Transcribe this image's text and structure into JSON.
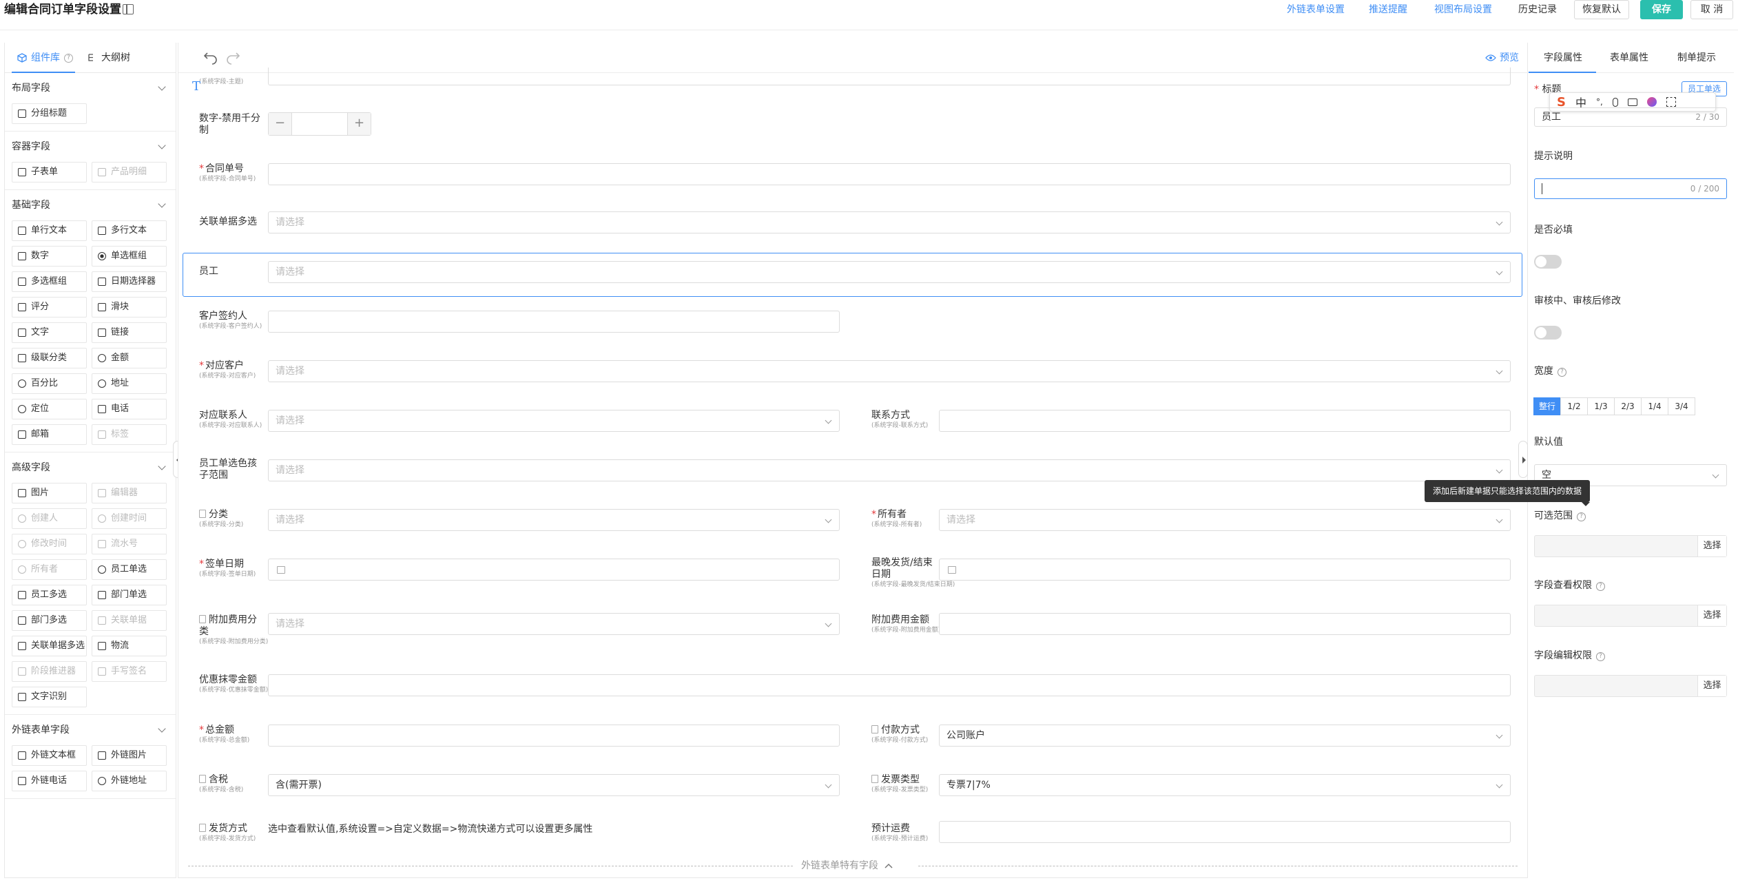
{
  "header": {
    "title": "编辑合同订单字段设置",
    "links": [
      "外链表单设置",
      "推送提醒",
      "视图布局设置"
    ],
    "history": "历史记录",
    "restore_label": "恢复默认",
    "save_label": "保存",
    "cancel_label": "取 消"
  },
  "left": {
    "tab_components": "组件库",
    "tab_outline": "大纲树",
    "sections": [
      {
        "title": "布局字段",
        "items": [
          {
            "label": "分组标题",
            "icon": "group-title-icon",
            "disabled": false
          }
        ]
      },
      {
        "title": "容器字段",
        "items": [
          {
            "label": "子表单",
            "icon": "table-icon",
            "disabled": false
          },
          {
            "label": "产品明细",
            "icon": "table-icon",
            "disabled": true
          }
        ]
      },
      {
        "title": "基础字段",
        "items": [
          {
            "label": "单行文本",
            "icon": "input-icon",
            "disabled": false
          },
          {
            "label": "多行文本",
            "icon": "textarea-icon",
            "disabled": false
          },
          {
            "label": "数字",
            "icon": "number-icon",
            "disabled": false
          },
          {
            "label": "单选框组",
            "icon": "radio-icon",
            "disabled": false
          },
          {
            "label": "多选框组",
            "icon": "checkbox-icon",
            "disabled": false
          },
          {
            "label": "日期选择器",
            "icon": "calendar-icon",
            "disabled": false
          },
          {
            "label": "评分",
            "icon": "star-icon",
            "disabled": false
          },
          {
            "label": "滑块",
            "icon": "slider-icon",
            "disabled": false
          },
          {
            "label": "文字",
            "icon": "text-icon",
            "disabled": false
          },
          {
            "label": "链接",
            "icon": "link-icon",
            "disabled": false
          },
          {
            "label": "级联分类",
            "icon": "cascade-icon",
            "disabled": false
          },
          {
            "label": "金额",
            "icon": "money-icon",
            "disabled": false
          },
          {
            "label": "百分比",
            "icon": "percent-icon",
            "disabled": false
          },
          {
            "label": "地址",
            "icon": "location-pin-icon",
            "disabled": false
          },
          {
            "label": "定位",
            "icon": "locate-icon",
            "disabled": false
          },
          {
            "label": "电话",
            "icon": "phone-icon",
            "disabled": false
          },
          {
            "label": "邮箱",
            "icon": "mail-icon",
            "disabled": false
          },
          {
            "label": "标签",
            "icon": "tag-icon",
            "disabled": true
          }
        ]
      },
      {
        "title": "高级字段",
        "items": [
          {
            "label": "图片",
            "icon": "image-icon",
            "disabled": false
          },
          {
            "label": "编辑器",
            "icon": "editor-icon",
            "disabled": true
          },
          {
            "label": "创建人",
            "icon": "user-icon",
            "disabled": true
          },
          {
            "label": "创建时间",
            "icon": "clock-icon",
            "disabled": true
          },
          {
            "label": "修改时间",
            "icon": "clock-icon",
            "disabled": true
          },
          {
            "label": "流水号",
            "icon": "serial-icon",
            "disabled": true
          },
          {
            "label": "所有者",
            "icon": "clock-icon",
            "disabled": true
          },
          {
            "label": "员工单选",
            "icon": "user-icon",
            "disabled": false
          },
          {
            "label": "员工多选",
            "icon": "users-icon",
            "disabled": false
          },
          {
            "label": "部门单选",
            "icon": "dept-icon",
            "disabled": false
          },
          {
            "label": "部门多选",
            "icon": "dept-icon",
            "disabled": false
          },
          {
            "label": "关联单据",
            "icon": "link-icon",
            "disabled": true
          },
          {
            "label": "关联单据多选",
            "icon": "link-icon",
            "disabled": false
          },
          {
            "label": "物流",
            "icon": "truck-icon",
            "disabled": false
          },
          {
            "label": "阶段推进器",
            "icon": "stage-icon",
            "disabled": true
          },
          {
            "label": "手写签名",
            "icon": "signature-icon",
            "disabled": true
          },
          {
            "label": "文字识别",
            "icon": "ocr-icon",
            "disabled": false
          }
        ]
      },
      {
        "title": "外链表单字段",
        "items": [
          {
            "label": "外链文本框",
            "icon": "input-icon",
            "disabled": false
          },
          {
            "label": "外链图片",
            "icon": "image-icon",
            "disabled": false
          },
          {
            "label": "外链电话",
            "icon": "phone-icon",
            "disabled": false
          },
          {
            "label": "外链地址",
            "icon": "location-pin-icon",
            "disabled": false
          }
        ]
      }
    ]
  },
  "canvas": {
    "preview": "预览",
    "top_cut_sub": "(系统字段-主题)",
    "fields": {
      "number": {
        "label": "数字-禁用千分制"
      },
      "contract_no": {
        "label": "合同单号",
        "sub": "(系统字段-合同单号)"
      },
      "related_multi": {
        "label": "关联单据多选",
        "placeholder": "请选择"
      },
      "employee": {
        "label": "员工",
        "placeholder": "请选择"
      },
      "customer_signer": {
        "label": "客户签约人",
        "sub": "(系统字段-客户签约人)"
      },
      "customer": {
        "label": "对应客户",
        "sub": "(系统字段-对应客户)",
        "placeholder": "请选择"
      },
      "contact": {
        "label": "对应联系人",
        "sub": "(系统字段-对应联系人)",
        "placeholder": "请选择"
      },
      "contact_method": {
        "label": "联系方式",
        "sub": "(系统字段-联系方式)"
      },
      "employee_color": {
        "label": "员工单选色孩子范围",
        "placeholder": "请选择"
      },
      "category": {
        "label": "分类",
        "sub": "(系统字段-分类)",
        "placeholder": "请选择"
      },
      "owner": {
        "label": "所有者",
        "sub": "(系统字段-所有者)",
        "placeholder": "请选择"
      },
      "sign_date": {
        "label": "签单日期",
        "sub": "(系统字段-签单日期)"
      },
      "ship_end": {
        "label": "最晚发货/结束日期",
        "sub": "(系统字段-最晚发货/结束日期)"
      },
      "extra_cat": {
        "label": "附加费用分类",
        "sub": "(系统字段-附加费用分类)",
        "placeholder": "请选择"
      },
      "extra_amt": {
        "label": "附加费用金额",
        "sub": "(系统字段-附加费用金额)"
      },
      "discount": {
        "label": "优惠抹零金额",
        "sub": "(系统字段-优惠抹零金额)"
      },
      "total": {
        "label": "总金额",
        "sub": "(系统字段-总金额)"
      },
      "pay_method": {
        "label": "付款方式",
        "sub": "(系统字段-付款方式)",
        "value": "公司账户"
      },
      "tax": {
        "label": "含税",
        "sub": "(系统字段-含税)",
        "value": "含(需开票)"
      },
      "invoice_type": {
        "label": "发票类型",
        "sub": "(系统字段-发票类型)",
        "value": "专票7|7%"
      },
      "ship_method": {
        "label": "发货方式",
        "sub": "(系统字段-发货方式)",
        "text": "选中查看默认值,系统设置=>自定义数据=>物流快递方式可以设置更多属性"
      },
      "freight": {
        "label": "预计运费",
        "sub": "(系统字段-预计运费)"
      }
    },
    "divider_label": "外链表单特有字段"
  },
  "right": {
    "tabs": [
      "字段属性",
      "表单属性",
      "制单提示"
    ],
    "title_label": "标题",
    "tag_button": "员工单选",
    "title_value": "员工",
    "title_count": "2 / 30",
    "hint_label": "提示说明",
    "hint_count": "0 / 200",
    "required_label": "是否必填",
    "edit_label": "审核中、审核后修改",
    "width_label": "宽度",
    "width_options": [
      "整行",
      "1/2",
      "1/3",
      "2/3",
      "1/4",
      "3/4"
    ],
    "width_selected": "整行",
    "default_label": "默认值",
    "default_value": "空",
    "range_label": "可选范围",
    "view_perm_label": "字段查看权限",
    "edit_perm_label": "字段编辑权限",
    "pick_label": "选择",
    "ime": [
      "中"
    ]
  },
  "tooltip": "添加后新建单据只能选择该范围内的数据",
  "colors": {
    "accent": "#3f8ef5",
    "save": "#2bbfae",
    "required": "#e4393c"
  }
}
